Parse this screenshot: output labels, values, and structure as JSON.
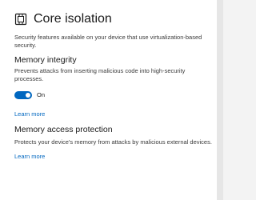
{
  "header": {
    "icon": "shield-chip-icon",
    "title": "Core isolation"
  },
  "intro": "Security features available on your device that use virtualization-based security.",
  "memory_integrity": {
    "title": "Memory integrity",
    "description": "Prevents attacks from inserting malicious code into high-security processes.",
    "toggle_state": "On",
    "learn_more": "Learn more"
  },
  "memory_access_protection": {
    "title": "Memory access protection",
    "description": "Protects your device's memory from attacks by malicious external devices.",
    "learn_more": "Learn more"
  },
  "colors": {
    "accent": "#0067c0",
    "background": "#ffffff",
    "text": "#1a1a1a",
    "secondary_text": "#3b3b3b"
  }
}
